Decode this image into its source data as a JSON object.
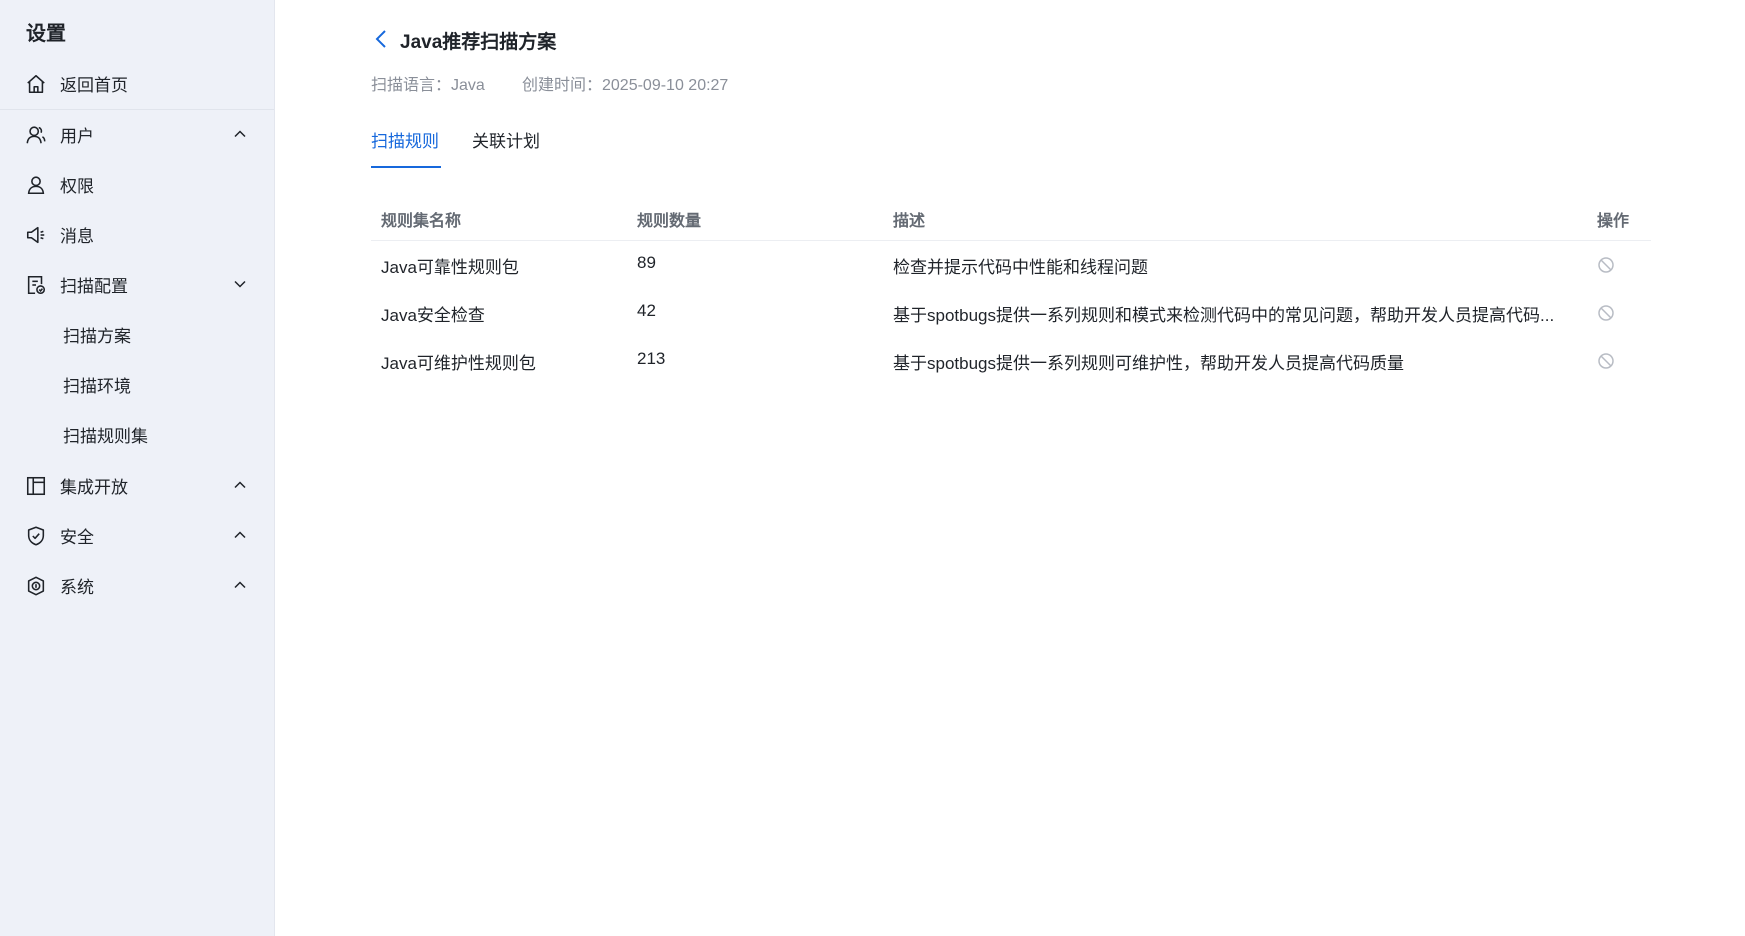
{
  "sidebar": {
    "title": "设置",
    "items": [
      {
        "label": "返回首页"
      },
      {
        "label": "用户"
      },
      {
        "label": "权限"
      },
      {
        "label": "消息"
      },
      {
        "label": "扫描配置"
      },
      {
        "label": "扫描方案"
      },
      {
        "label": "扫描环境"
      },
      {
        "label": "扫描规则集"
      },
      {
        "label": "集成开放"
      },
      {
        "label": "安全"
      },
      {
        "label": "系统"
      }
    ]
  },
  "header": {
    "title": "Java推荐扫描方案",
    "scan_language": "扫描语言：Java",
    "created_time": "创建时间：2025-09-10 20:27"
  },
  "tabs": [
    {
      "label": "扫描规则",
      "active": true
    },
    {
      "label": "关联计划",
      "active": false
    }
  ],
  "table": {
    "columns": [
      "规则集名称",
      "规则数量",
      "描述",
      "操作"
    ],
    "rows": [
      {
        "name": "Java可靠性规则包",
        "count": "89",
        "desc": "检查并提示代码中性能和线程问题"
      },
      {
        "name": "Java安全检查",
        "count": "42",
        "desc": "基于spotbugs提供一系列规则和模式来检测代码中的常见问题，帮助开发人员提高代码..."
      },
      {
        "name": "Java可维护性规则包",
        "count": "213",
        "desc": "基于spotbugs提供一系列规则可维护性，帮助开发人员提高代码质量"
      }
    ]
  },
  "colors": {
    "accent": "#1668dc",
    "sidebar_bg": "#eef1f8",
    "muted_text": "#8a8f99"
  }
}
